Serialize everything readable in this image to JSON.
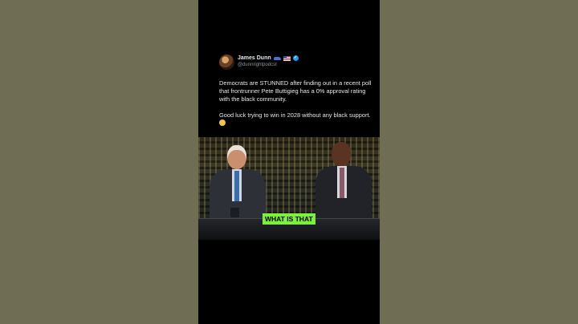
{
  "tweet": {
    "author_name": "James Dunn",
    "handle": "@dunnrightpodcst",
    "paragraph1": "Democrats are STUNNED after finding out in a recent poll that frontrunner Pete Buttigieg has a 0% approval rating with the black community.",
    "paragraph2": "Good luck trying to win in 2028 without any black support.",
    "icons": [
      "car-icon",
      "us-flag-icon",
      "verified-badge-icon",
      "laughing-emoji-icon"
    ],
    "verified_color": "#1d9bf0"
  },
  "clip": {
    "caption": "WHAT IS THAT",
    "caption_color": "#7cf03c"
  },
  "page": {
    "side_color": "#6f6e55",
    "video_bg": "#000000"
  }
}
